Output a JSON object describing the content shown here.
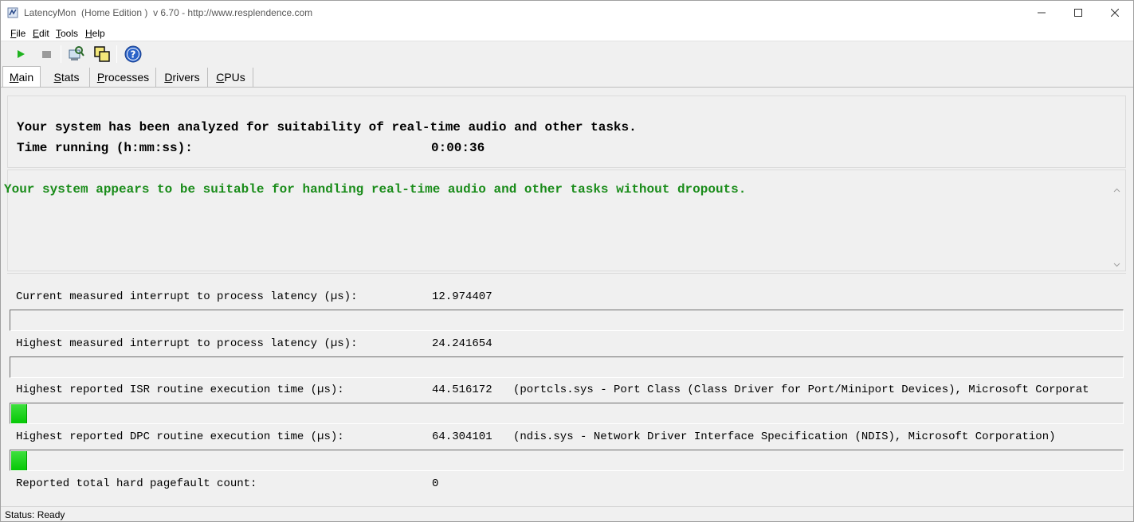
{
  "window": {
    "title": "LatencyMon  (Home Edition )  v 6.70 - http://www.resplendence.com"
  },
  "menu": [
    {
      "mnemonic": "F",
      "rest": "ile"
    },
    {
      "mnemonic": "E",
      "rest": "dit"
    },
    {
      "mnemonic": "T",
      "rest": "ools"
    },
    {
      "mnemonic": "H",
      "rest": "elp"
    }
  ],
  "toolbar": {
    "icons": [
      "play-icon",
      "stop-icon",
      "analyze-icon",
      "windows-icon",
      "help-icon"
    ]
  },
  "tabs": [
    {
      "mnemonic": "M",
      "rest": "ain",
      "active": true
    },
    {
      "mnemonic": "S",
      "rest": "tats",
      "active": false
    },
    {
      "mnemonic": "P",
      "rest": "rocesses",
      "active": false
    },
    {
      "mnemonic": "D",
      "rest": "rivers",
      "active": false
    },
    {
      "mnemonic": "C",
      "rest": "PUs",
      "active": false
    }
  ],
  "summary": {
    "analyzed_text": "Your system has been analyzed for suitability of real-time audio and other tasks.",
    "time_label": "Time running (h:mm:ss):",
    "time_value": "0:00:36"
  },
  "verdict": {
    "text": "Your system appears to be suitable for handling real-time audio and other tasks without dropouts.",
    "color": "#1a8c1a"
  },
  "stats": {
    "current_latency": {
      "label": "Current measured interrupt to process latency (µs):",
      "value": "12.974407",
      "level": 0
    },
    "highest_latency": {
      "label": "Highest measured interrupt to process latency (µs):",
      "value": "24.241654",
      "level": 0
    },
    "isr": {
      "label": "Highest reported ISR routine execution time (µs):",
      "value": "44.516172",
      "detail": "(portcls.sys - Port Class (Class Driver for Port/Miniport Devices), Microsoft Corporat",
      "level": 0.014
    },
    "dpc": {
      "label": "Highest reported DPC routine execution time (µs):",
      "value": "64.304101",
      "detail": "(ndis.sys - Network Driver Interface Specification (NDIS), Microsoft Corporation)",
      "level": 0.014
    },
    "pagefault": {
      "label": "Reported total hard pagefault count:",
      "value": "0"
    }
  },
  "status": {
    "text": "Status: Ready"
  }
}
